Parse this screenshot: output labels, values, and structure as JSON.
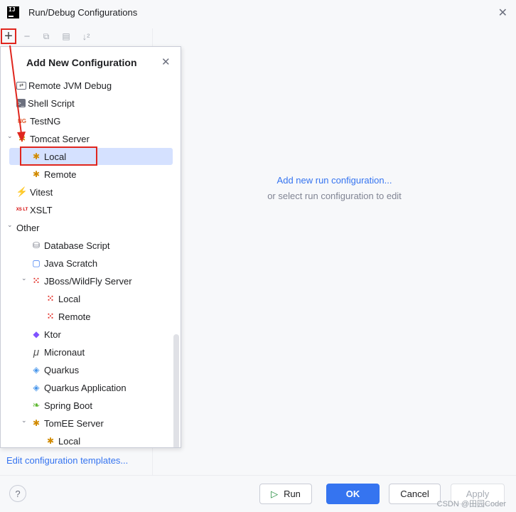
{
  "window": {
    "title": "Run/Debug Configurations",
    "app_icon": "IJ"
  },
  "toolbar": {
    "add": "+",
    "remove": "−",
    "copy": "⧉",
    "folder": "▤",
    "sort": "↓²"
  },
  "popup": {
    "title": "Add New Configuration",
    "items": [
      {
        "label": "Remote JVM Debug",
        "icon": "remote-debug-icon",
        "glyph": "⇄"
      },
      {
        "label": "Shell Script",
        "icon": "shell-script-icon",
        "glyph": ">_"
      },
      {
        "label": "TestNG",
        "icon": "testng-icon",
        "glyph": "NG"
      },
      {
        "label": "Tomcat Server",
        "icon": "tomcat-icon",
        "glyph": "✱"
      },
      {
        "label": "Local",
        "icon": "tomcat-icon",
        "glyph": "✱"
      },
      {
        "label": "Remote",
        "icon": "tomcat-icon",
        "glyph": "✱"
      },
      {
        "label": "Vitest",
        "icon": "vitest-icon",
        "glyph": "⚡"
      },
      {
        "label": "XSLT",
        "icon": "xslt-icon",
        "glyph": "XS LT"
      },
      {
        "label": "Other",
        "icon": "",
        "glyph": ""
      },
      {
        "label": "Database Script",
        "icon": "database-icon",
        "glyph": "⛁"
      },
      {
        "label": "Java Scratch",
        "icon": "java-scratch-icon",
        "glyph": "▢"
      },
      {
        "label": "JBoss/WildFly Server",
        "icon": "jboss-icon",
        "glyph": "⁙"
      },
      {
        "label": "Local",
        "icon": "jboss-icon",
        "glyph": "⁙"
      },
      {
        "label": "Remote",
        "icon": "jboss-icon",
        "glyph": "⁙"
      },
      {
        "label": "Ktor",
        "icon": "ktor-icon",
        "glyph": "◆"
      },
      {
        "label": "Micronaut",
        "icon": "micronaut-icon",
        "glyph": "μ"
      },
      {
        "label": "Quarkus",
        "icon": "quarkus-icon",
        "glyph": "◈"
      },
      {
        "label": "Quarkus Application",
        "icon": "quarkus-icon",
        "glyph": "◈"
      },
      {
        "label": "Spring Boot",
        "icon": "spring-boot-icon",
        "glyph": "❧"
      },
      {
        "label": "TomEE Server",
        "icon": "tomee-icon",
        "glyph": "✱"
      },
      {
        "label": "Local",
        "icon": "tomee-icon",
        "glyph": "✱"
      }
    ]
  },
  "empty_state": {
    "link": "Add new run configuration...",
    "hint": "or select run configuration to edit"
  },
  "footer": {
    "edit_templates": "Edit configuration templates...",
    "help": "?",
    "run": "Run",
    "ok": "OK",
    "cancel": "Cancel",
    "apply": "Apply"
  },
  "watermark": "CSDN @田园Coder",
  "colors": {
    "accent": "#3574f0",
    "selection": "#d5e1ff",
    "annotation": "#e0261e"
  }
}
